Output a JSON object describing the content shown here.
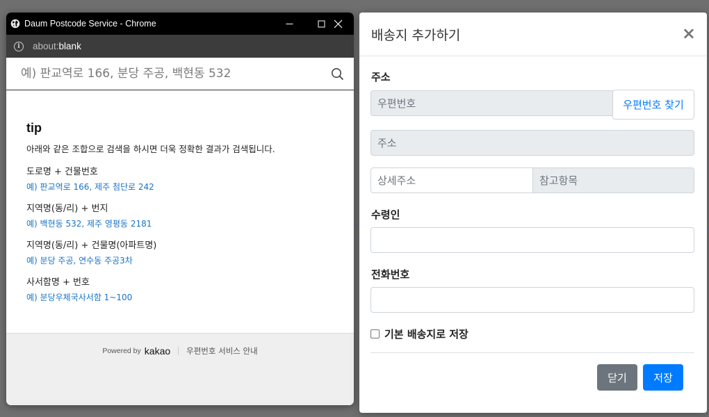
{
  "popup": {
    "window_title": "Daum Postcode Service - Chrome",
    "url_prefix": "about:",
    "url_main": "blank",
    "search_placeholder": "예) 판교역로 166, 분당 주공, 백현동 532",
    "tip": {
      "title": "tip",
      "description": "아래와 같은 조합으로 검색을 하시면 더욱 정확한 결과가 검색됩니다.",
      "entries": [
        {
          "label": "도로명 + 건물번호",
          "example": "예) 판교역로 166,  제주 첨단로 242"
        },
        {
          "label": "지역명(동/리) + 번지",
          "example": "예) 백현동 532,  제주 영평동 2181"
        },
        {
          "label": "지역명(동/리) + 건물명(아파트명)",
          "example": "예) 분당 주공,  연수동 주공3차"
        },
        {
          "label": "사서함명 + 번호",
          "example": "예) 분당우체국사서함 1~100"
        }
      ]
    },
    "footer": {
      "powered_by": "Powered by",
      "brand": "kakao",
      "guide_link": "우편번호 서비스 안내"
    }
  },
  "modal": {
    "title": "배송지 추가하기",
    "close_symbol": "×",
    "address": {
      "label": "주소",
      "postcode_placeholder": "우편번호",
      "find_button": "우편번호 찾기",
      "address_placeholder": "주소",
      "detail_placeholder": "상세주소",
      "extra_placeholder": "참고항목"
    },
    "recipient": {
      "label": "수령인",
      "value": ""
    },
    "phone": {
      "label": "전화번호",
      "value": ""
    },
    "default_checkbox": {
      "label": "기본 배송지로 저장",
      "checked": false
    },
    "buttons": {
      "close": "닫기",
      "save": "저장"
    }
  },
  "colors": {
    "primary": "#007bff",
    "secondary": "#6c757d",
    "link_blue": "#1a73c7"
  }
}
